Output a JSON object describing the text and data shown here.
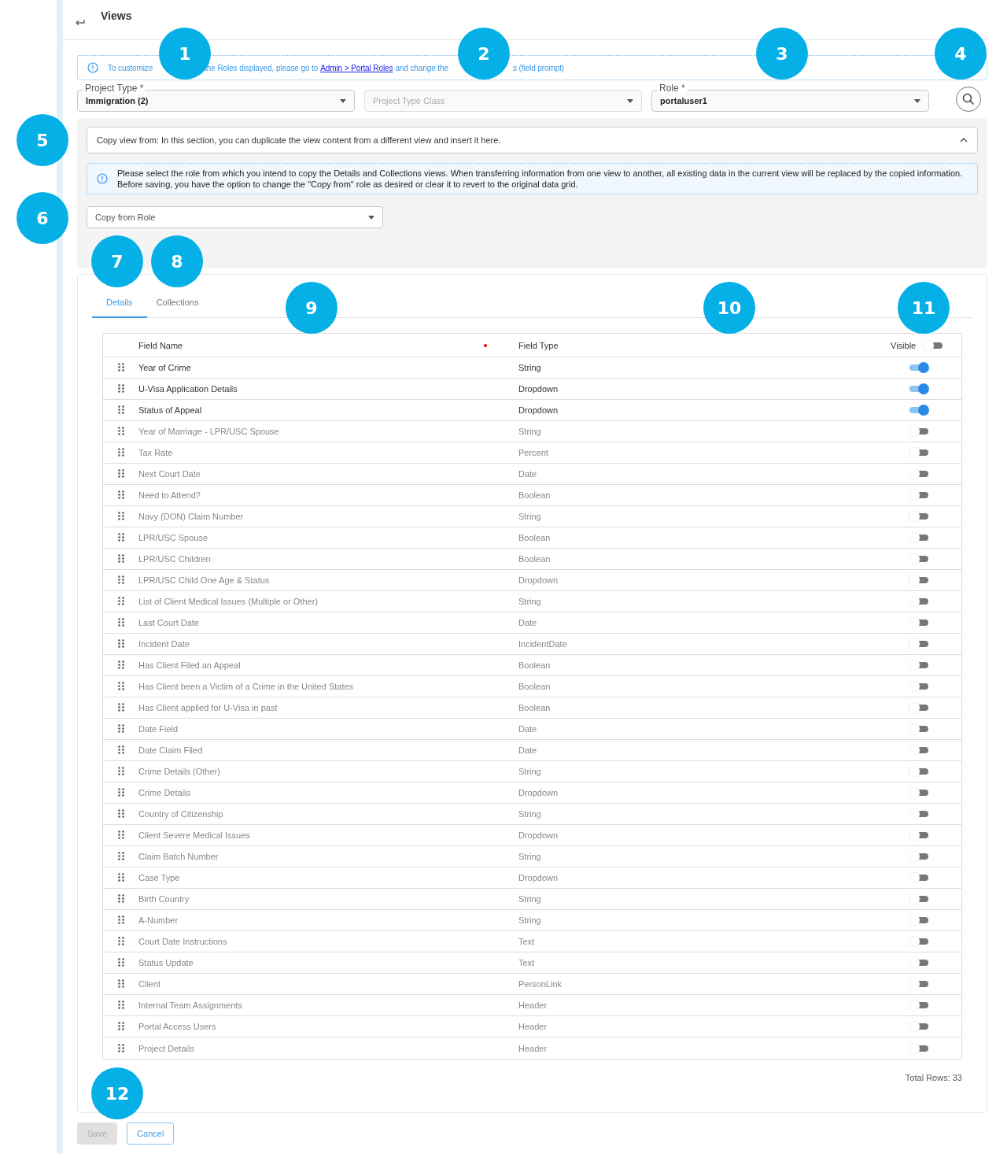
{
  "header": {
    "title": "Views"
  },
  "notice": {
    "text_1": "To customize",
    "text_2": "the Roles displayed, please go to",
    "link": "Admin > Portal Roles",
    "text_3": "and change the",
    "text_4": "s (field prompt)"
  },
  "filters": [
    {
      "kind": "select",
      "label": "Project Type *",
      "value": "Immigration (2)"
    },
    {
      "kind": "select",
      "placeholder": "Project Type Class",
      "disabled": true
    },
    {
      "kind": "select",
      "label": "Role *",
      "value": "portaluser1"
    }
  ],
  "copy_section": {
    "title": "Copy view from: In this section, you can duplicate the view content from a different view and insert it here.",
    "expanded": true,
    "info": "Please select the role from which you intend to copy the Details and Collections views. When transferring information from one view to another, all existing data in the current view will be replaced by the copied information. Before saving, you have the option to change the \"Copy from\" role as desired or clear it to revert to the original data grid.",
    "select_placeholder": "Copy from Role"
  },
  "tabs": [
    {
      "label": "Details",
      "selected": true
    },
    {
      "label": "Collections",
      "selected": false
    }
  ],
  "table": {
    "columns": [
      "Field Name",
      "Field Type",
      "Visible"
    ],
    "all_visible": false,
    "rows": [
      {
        "name": "Year of Crime",
        "type": "String",
        "visible": true
      },
      {
        "name": "U-Visa Application Details",
        "type": "Dropdown",
        "visible": true
      },
      {
        "name": "Status of Appeal",
        "type": "Dropdown",
        "visible": true
      },
      {
        "name": "Year of Marriage - LPR/USC Spouse",
        "type": "String",
        "visible": false
      },
      {
        "name": "Tax Rate",
        "type": "Percent",
        "visible": false
      },
      {
        "name": "Next Court Date",
        "type": "Date",
        "visible": false
      },
      {
        "name": "Need to Attend?",
        "type": "Boolean",
        "visible": false
      },
      {
        "name": "Navy (DON) Claim Number",
        "type": "String",
        "visible": false
      },
      {
        "name": "LPR/USC Spouse",
        "type": "Boolean",
        "visible": false
      },
      {
        "name": "LPR/USC Children",
        "type": "Boolean",
        "visible": false
      },
      {
        "name": "LPR/USC Child One Age & Status",
        "type": "Dropdown",
        "visible": false
      },
      {
        "name": "List of Client Medical Issues (Multiple or Other)",
        "type": "String",
        "visible": false
      },
      {
        "name": "Last Court Date",
        "type": "Date",
        "visible": false
      },
      {
        "name": "Incident Date",
        "type": "IncidentDate",
        "visible": false
      },
      {
        "name": "Has Client Filed an Appeal",
        "type": "Boolean",
        "visible": false
      },
      {
        "name": "Has Client been a Victim of a Crime in the United States",
        "type": "Boolean",
        "visible": false
      },
      {
        "name": "Has Client applied for U-Visa in past",
        "type": "Boolean",
        "visible": false
      },
      {
        "name": "Date Field",
        "type": "Date",
        "visible": false
      },
      {
        "name": "Date Claim Filed",
        "type": "Date",
        "visible": false
      },
      {
        "name": "Crime Details (Other)",
        "type": "String",
        "visible": false
      },
      {
        "name": "Crime Details",
        "type": "Dropdown",
        "visible": false
      },
      {
        "name": "Country of Citizenship",
        "type": "String",
        "visible": false
      },
      {
        "name": "Client Severe Medical Issues",
        "type": "Dropdown",
        "visible": false
      },
      {
        "name": "Claim Batch Number",
        "type": "String",
        "visible": false
      },
      {
        "name": "Case Type",
        "type": "Dropdown",
        "visible": false
      },
      {
        "name": "Birth Country",
        "type": "String",
        "visible": false
      },
      {
        "name": "A-Number",
        "type": "String",
        "visible": false
      },
      {
        "name": "Court Date Instructions",
        "type": "Text",
        "visible": false
      },
      {
        "name": "Status Update",
        "type": "Text",
        "visible": false
      },
      {
        "name": "Client",
        "type": "PersonLink",
        "visible": false
      },
      {
        "name": "Internal Team Assignments",
        "type": "Header",
        "visible": false
      },
      {
        "name": "Portal Access Users",
        "type": "Header",
        "visible": false
      },
      {
        "name": "Project Details",
        "type": "Header",
        "visible": false
      }
    ],
    "total": "Total Rows: 33"
  },
  "buttons": [
    {
      "label": "Save",
      "disabled": true
    },
    {
      "label": "Cancel",
      "disabled": false
    }
  ],
  "callouts": [
    "1",
    "2",
    "3",
    "4",
    "5",
    "6",
    "7",
    "8",
    "9",
    "10",
    "11",
    "12"
  ]
}
